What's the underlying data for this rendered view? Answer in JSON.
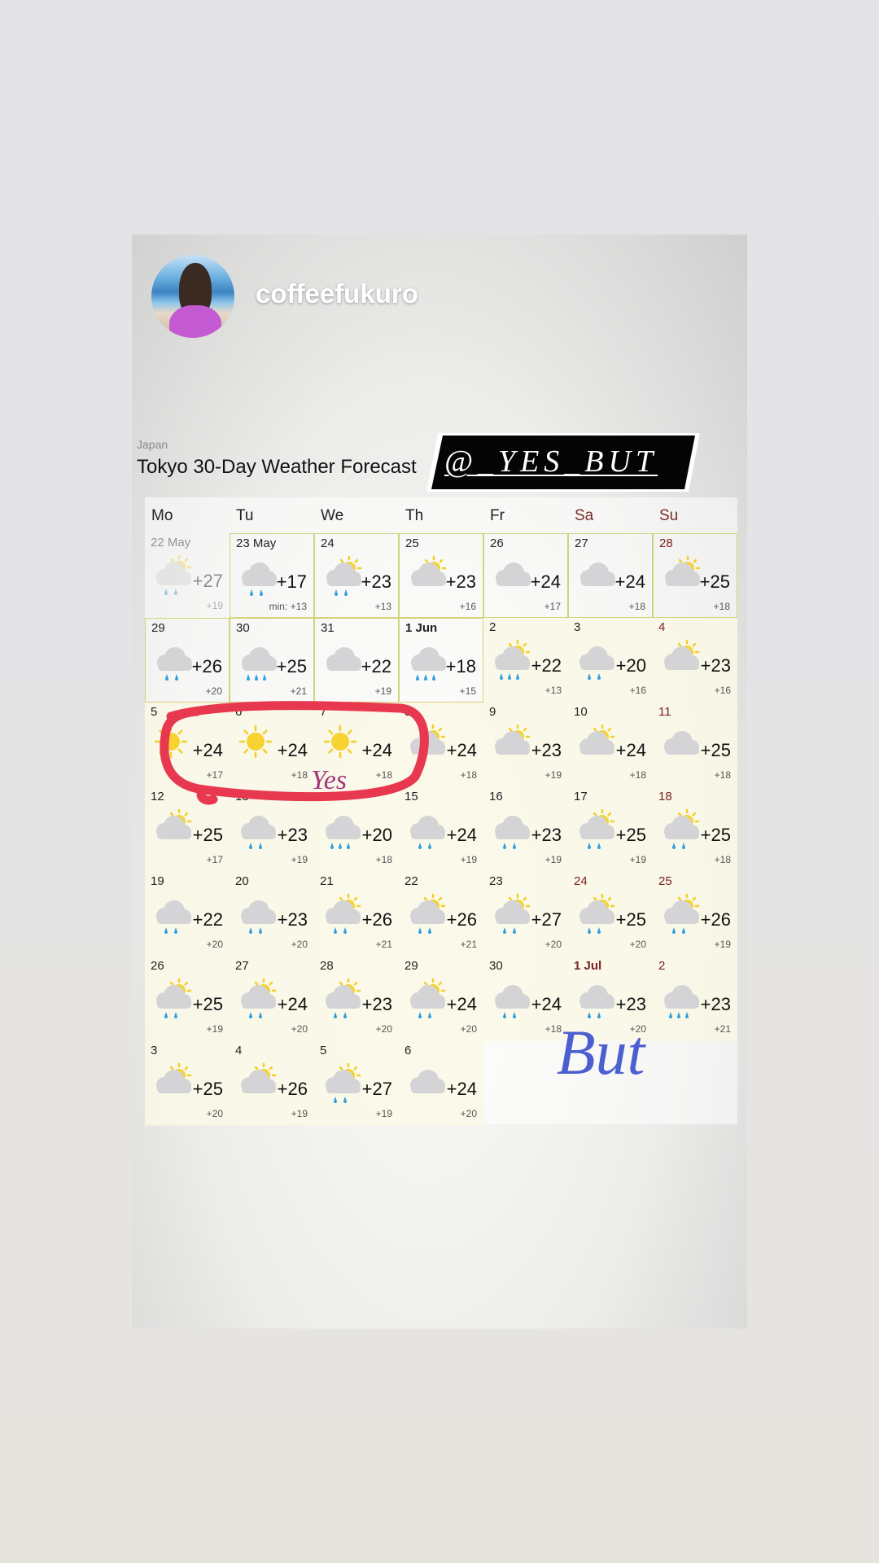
{
  "story": {
    "username": "coffeefukuro",
    "tag": "@_YES_BUT",
    "annotation_yes": "Yes",
    "annotation_but": "But",
    "circle_color": "#e8384f"
  },
  "forecast": {
    "region": "Japan",
    "title": "Tokyo 30-Day Weather Forecast",
    "weekdays": [
      "Mo",
      "Tu",
      "We",
      "Th",
      "Fr",
      "Sa",
      "Su"
    ],
    "weeks": [
      [
        {
          "d": "22 May",
          "hi": "+27",
          "lo": "+19",
          "icon": "partly-cloudy-rain-icon",
          "past": true
        },
        {
          "d": "23 May",
          "hi": "+17",
          "lo": "min: +13",
          "icon": "cloud-rain-icon",
          "hl": true
        },
        {
          "d": "24",
          "hi": "+23",
          "lo": "+13",
          "icon": "partly-cloudy-rain-icon",
          "hl": true
        },
        {
          "d": "25",
          "hi": "+23",
          "lo": "+16",
          "icon": "partly-cloudy-icon",
          "hl": true
        },
        {
          "d": "26",
          "hi": "+24",
          "lo": "+17",
          "icon": "cloud-icon",
          "hl": true
        },
        {
          "d": "27",
          "hi": "+24",
          "lo": "+18",
          "icon": "cloud-icon",
          "hl": true
        },
        {
          "d": "28",
          "hi": "+25",
          "lo": "+18",
          "icon": "partly-cloudy-icon",
          "hl": true,
          "red": true
        }
      ],
      [
        {
          "d": "29",
          "hi": "+26",
          "lo": "+20",
          "icon": "cloud-rain-icon",
          "hl": true
        },
        {
          "d": "30",
          "hi": "+25",
          "lo": "+21",
          "icon": "cloud-heavy-rain-icon",
          "hl": true
        },
        {
          "d": "31",
          "hi": "+22",
          "lo": "+19",
          "icon": "cloud-icon",
          "hl": true
        },
        {
          "d": "1 Jun",
          "hi": "+18",
          "lo": "+15",
          "icon": "cloud-heavy-rain-icon",
          "hl": true,
          "bold": true
        },
        {
          "d": "2",
          "hi": "+22",
          "lo": "+13",
          "icon": "partly-cloudy-heavy-rain-icon"
        },
        {
          "d": "3",
          "hi": "+20",
          "lo": "+16",
          "icon": "cloud-rain-icon"
        },
        {
          "d": "4",
          "hi": "+23",
          "lo": "+16",
          "icon": "partly-cloudy-icon",
          "red": true
        }
      ],
      [
        {
          "d": "5",
          "hi": "+24",
          "lo": "+17",
          "icon": "sun-icon"
        },
        {
          "d": "6",
          "hi": "+24",
          "lo": "+18",
          "icon": "sun-icon"
        },
        {
          "d": "7",
          "hi": "+24",
          "lo": "+18",
          "icon": "sun-icon"
        },
        {
          "d": "8",
          "hi": "+24",
          "lo": "+18",
          "icon": "partly-cloudy-icon"
        },
        {
          "d": "9",
          "hi": "+23",
          "lo": "+19",
          "icon": "partly-cloudy-icon"
        },
        {
          "d": "10",
          "hi": "+24",
          "lo": "+18",
          "icon": "partly-cloudy-icon"
        },
        {
          "d": "11",
          "hi": "+25",
          "lo": "+18",
          "icon": "cloud-icon",
          "red": true
        }
      ],
      [
        {
          "d": "12",
          "hi": "+25",
          "lo": "+17",
          "icon": "partly-cloudy-icon"
        },
        {
          "d": "13",
          "hi": "+23",
          "lo": "+19",
          "icon": "cloud-rain-icon"
        },
        {
          "d": "14",
          "hi": "+20",
          "lo": "+18",
          "icon": "cloud-heavy-rain-icon"
        },
        {
          "d": "15",
          "hi": "+24",
          "lo": "+19",
          "icon": "cloud-rain-icon"
        },
        {
          "d": "16",
          "hi": "+23",
          "lo": "+19",
          "icon": "cloud-rain-icon"
        },
        {
          "d": "17",
          "hi": "+25",
          "lo": "+19",
          "icon": "partly-cloudy-rain-icon"
        },
        {
          "d": "18",
          "hi": "+25",
          "lo": "+18",
          "icon": "partly-cloudy-rain-icon",
          "red": true
        }
      ],
      [
        {
          "d": "19",
          "hi": "+22",
          "lo": "+20",
          "icon": "cloud-rain-icon"
        },
        {
          "d": "20",
          "hi": "+23",
          "lo": "+20",
          "icon": "cloud-rain-icon"
        },
        {
          "d": "21",
          "hi": "+26",
          "lo": "+21",
          "icon": "partly-cloudy-rain-icon"
        },
        {
          "d": "22",
          "hi": "+26",
          "lo": "+21",
          "icon": "partly-cloudy-rain-icon"
        },
        {
          "d": "23",
          "hi": "+27",
          "lo": "+20",
          "icon": "partly-cloudy-rain-icon"
        },
        {
          "d": "24",
          "hi": "+25",
          "lo": "+20",
          "icon": "partly-cloudy-rain-icon",
          "red": true
        },
        {
          "d": "25",
          "hi": "+26",
          "lo": "+19",
          "icon": "partly-cloudy-rain-icon",
          "red": true
        }
      ],
      [
        {
          "d": "26",
          "hi": "+25",
          "lo": "+19",
          "icon": "partly-cloudy-rain-icon"
        },
        {
          "d": "27",
          "hi": "+24",
          "lo": "+20",
          "icon": "partly-cloudy-rain-icon"
        },
        {
          "d": "28",
          "hi": "+23",
          "lo": "+20",
          "icon": "partly-cloudy-rain-icon"
        },
        {
          "d": "29",
          "hi": "+24",
          "lo": "+20",
          "icon": "partly-cloudy-rain-icon"
        },
        {
          "d": "30",
          "hi": "+24",
          "lo": "+18",
          "icon": "cloud-rain-icon"
        },
        {
          "d": "1 Jul",
          "hi": "+23",
          "lo": "+20",
          "icon": "cloud-rain-icon",
          "red": true,
          "bold": true
        },
        {
          "d": "2",
          "hi": "+23",
          "lo": "+21",
          "icon": "cloud-heavy-rain-icon",
          "red": true
        }
      ],
      [
        {
          "d": "3",
          "hi": "+25",
          "lo": "+20",
          "icon": "partly-cloudy-icon"
        },
        {
          "d": "4",
          "hi": "+26",
          "lo": "+19",
          "icon": "partly-cloudy-icon"
        },
        {
          "d": "5",
          "hi": "+27",
          "lo": "+19",
          "icon": "partly-cloudy-rain-icon"
        },
        {
          "d": "6",
          "hi": "+24",
          "lo": "+20",
          "icon": "cloud-icon"
        }
      ]
    ]
  }
}
